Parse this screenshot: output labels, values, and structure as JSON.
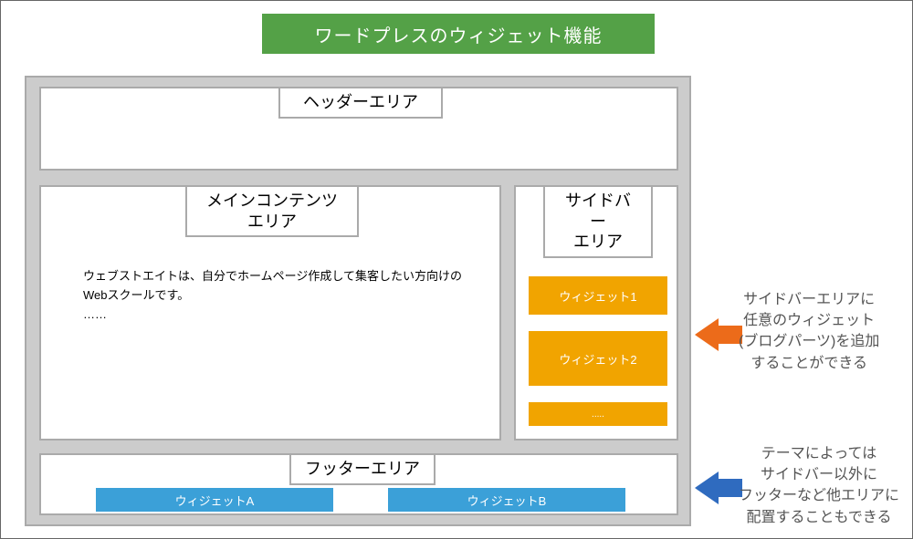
{
  "title": "ワードプレスのウィジェット機能",
  "layout": {
    "header_label": "ヘッダーエリア",
    "main_label": "メインコンテンツ\nエリア",
    "main_text_line1": "ウェブストエイトは、自分でホームページ作成して集客したい方向けのWebスクールです。",
    "main_text_line2": "……",
    "sidebar_label": "サイドバー\nエリア",
    "sidebar_widgets": [
      "ウィジェット1",
      "ウィジェット2",
      "....."
    ],
    "footer_label": "フッターエリア",
    "footer_widgets": [
      "ウィジェットA",
      "ウィジェットB"
    ]
  },
  "annotations": {
    "sidebar_note": "サイドバーエリアに\n任意のウィジェット\n(ブログパーツ)を追加\nすることができる",
    "footer_note": "テーマによっては\nサイドバー以外に\nフッターなど他エリアに\n配置することもできる"
  }
}
